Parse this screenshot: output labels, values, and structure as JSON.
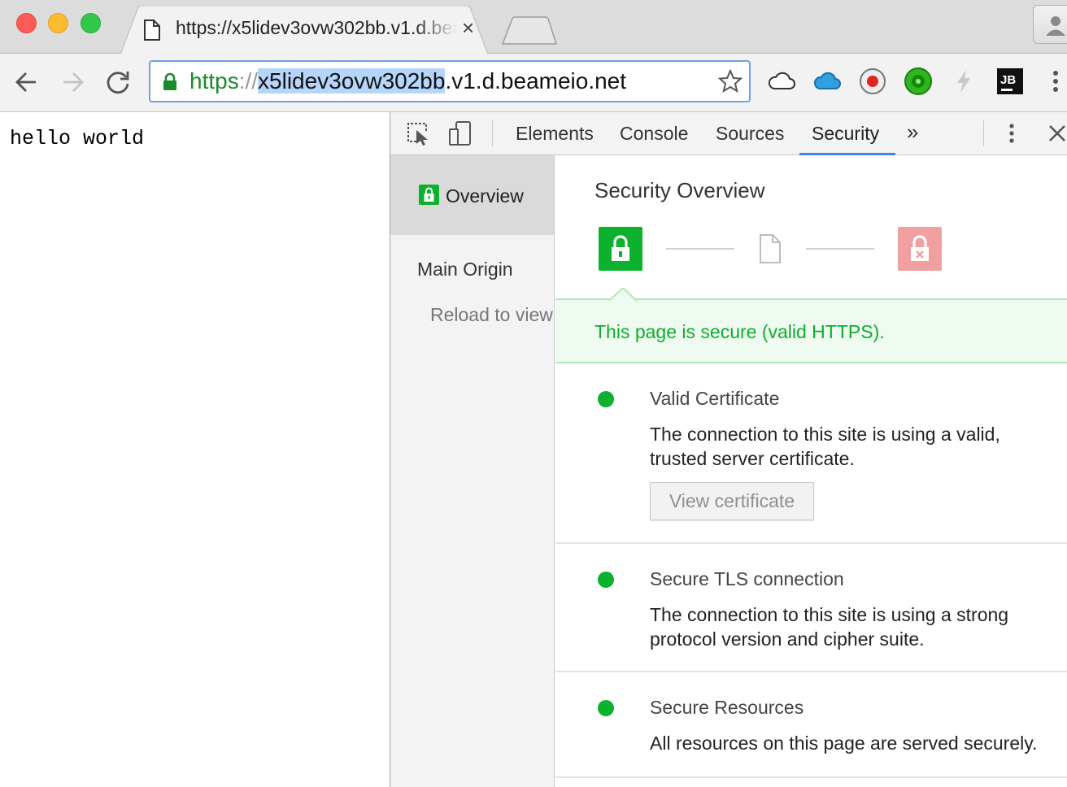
{
  "browser": {
    "tab": {
      "title": "https://x5lidev3ovw302bb.v1.d.beameio.net",
      "close_glyph": "×"
    },
    "omnibox": {
      "scheme": "https",
      "separator": "://",
      "host_selected": "x5lidev3ovw302bb",
      "host_rest": ".v1.d.beameio.net"
    },
    "extensions": [
      "cloud-outline-icon",
      "cloud-blue-icon",
      "record-icon",
      "green-circle-icon",
      "lightning-icon",
      "jb-icon"
    ],
    "jb_label": "JB"
  },
  "page": {
    "content": "hello world"
  },
  "devtools": {
    "tabs": [
      {
        "label": "Elements"
      },
      {
        "label": "Console"
      },
      {
        "label": "Sources"
      },
      {
        "label": "Security",
        "active": true
      }
    ],
    "more_tabs": "»",
    "sidebar": {
      "overview": "Overview",
      "main_origin": "Main Origin",
      "reload": "Reload to view"
    },
    "security": {
      "heading": "Security Overview",
      "summary": "This page is secure (valid HTTPS).",
      "summary_color": "#0cae2c",
      "sections": [
        {
          "title": "Valid Certificate",
          "description": "The connection to this site is using a valid, trusted server certificate.",
          "button": "View certificate",
          "status": "secure"
        },
        {
          "title": "Secure TLS connection",
          "description": "The connection to this site is using a strong protocol version and cipher suite.",
          "status": "secure"
        },
        {
          "title": "Secure Resources",
          "description": "All resources on this page are served securely.",
          "status": "secure"
        }
      ]
    }
  },
  "colors": {
    "secure_green": "#0cb12d",
    "insecure_red": "#f0a0a0",
    "selection_blue": "#b6d5fb",
    "tab_underline": "#3e82f7"
  }
}
